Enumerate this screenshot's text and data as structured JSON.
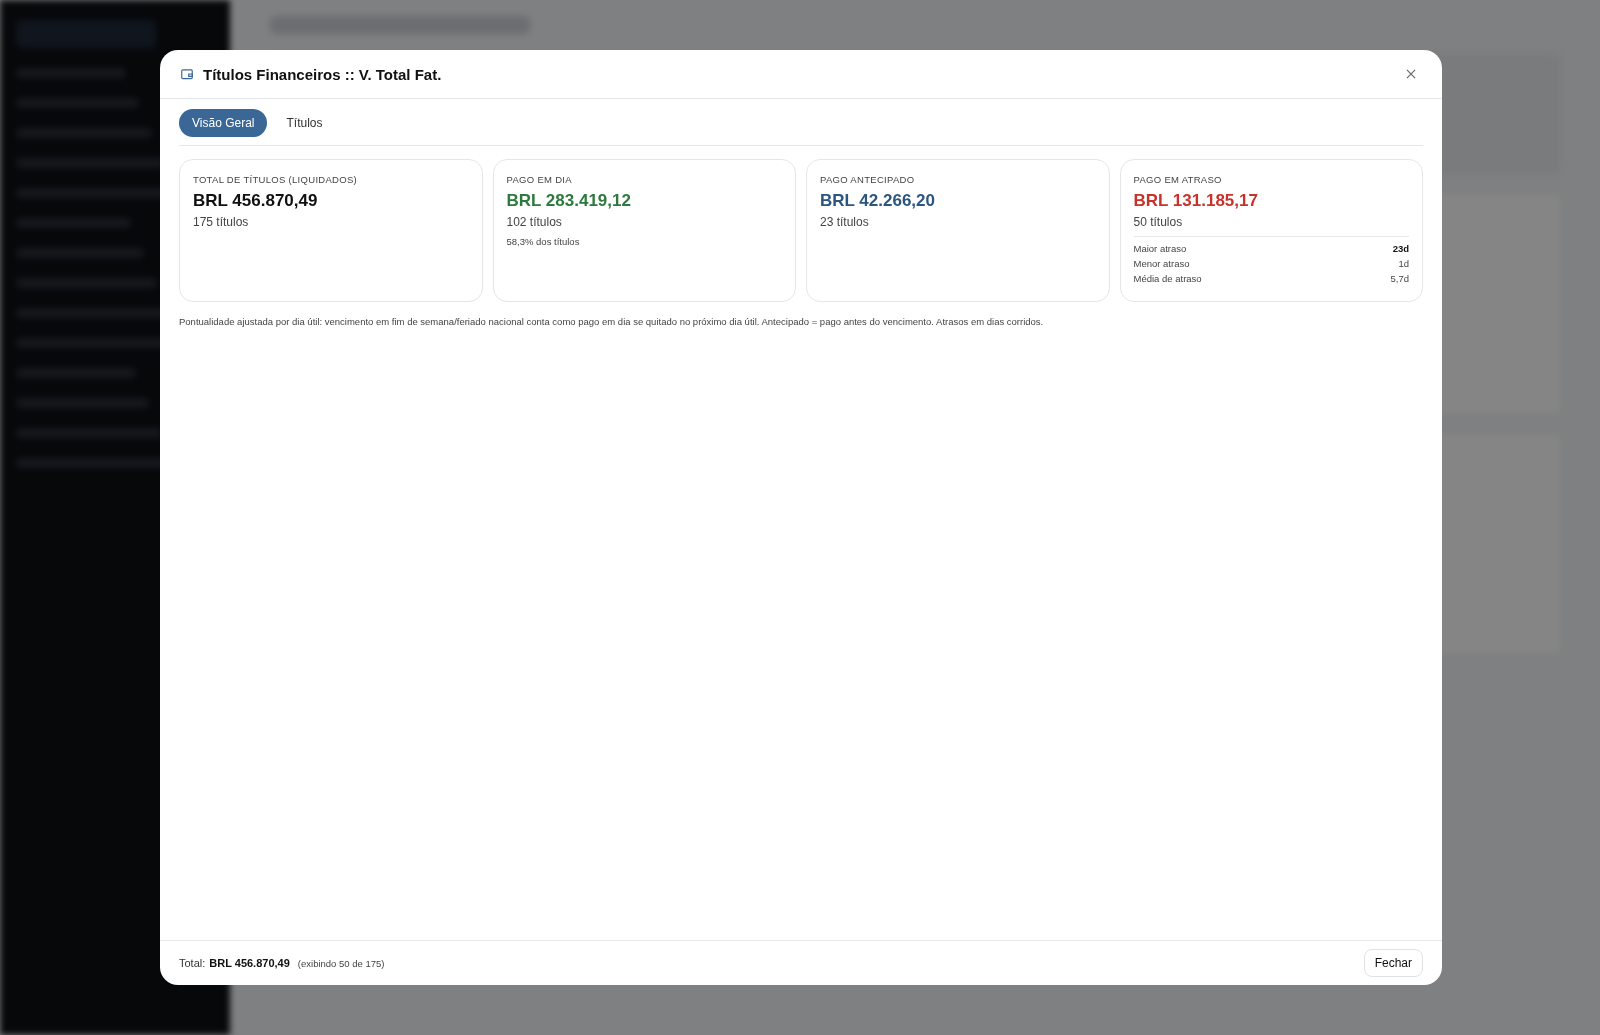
{
  "modal": {
    "title": "Títulos Financeiros :: V. Total Fat.",
    "tabs": [
      {
        "label": "Visão Geral",
        "selected": true
      },
      {
        "label": "Títulos",
        "selected": false
      }
    ],
    "cards": [
      {
        "label": "TOTAL DE TÍTULOS (LIQUIDADOS)",
        "amount": "BRL 456.870,49",
        "count": "175 títulos",
        "color": "#111111"
      },
      {
        "label": "PAGO EM DIA",
        "amount": "BRL 283.419,12",
        "count": "102 títulos",
        "note": "58,3% dos títulos",
        "color": "#2c7a3e"
      },
      {
        "label": "PAGO ANTECIPADO",
        "amount": "BRL 42.266,20",
        "count": "23 títulos",
        "color": "#2c5580"
      },
      {
        "label": "PAGO EM ATRASO",
        "amount": "BRL 131.185,17",
        "count": "50 títulos",
        "color": "#c8322b",
        "stats": [
          {
            "label": "Maior atraso",
            "value": "23d",
            "strong": true
          },
          {
            "label": "Menor atraso",
            "value": "1d",
            "strong": false
          },
          {
            "label": "Média de atraso",
            "value": "5,7d",
            "strong": false
          }
        ]
      }
    ],
    "footnote": "Pontualidade ajustada por dia útil: vencimento em fim de semana/feriado nacional conta como pago em dia se quitado no próximo dia útil. Antecipado = pago antes do vencimento. Atrasos em dias corridos.",
    "footer": {
      "total_label": "Total:",
      "total": "BRL 456.870,49",
      "shown": "(exibindo 50 de 175)",
      "close_button": "Fechar"
    }
  }
}
